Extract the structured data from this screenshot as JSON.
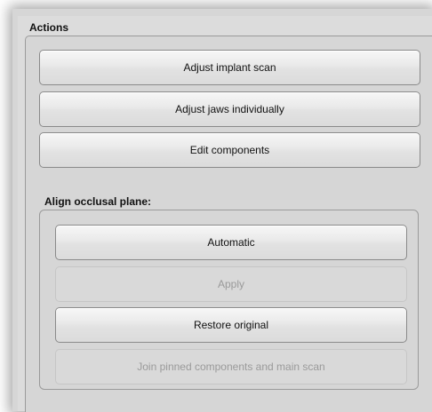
{
  "actions_panel": {
    "title": "Actions",
    "buttons": [
      {
        "label": "Adjust implant scan",
        "enabled": true
      },
      {
        "label": "Adjust jaws individually",
        "enabled": true
      },
      {
        "label": "Edit components",
        "enabled": true
      }
    ]
  },
  "align_panel": {
    "title": "Align occlusal plane:",
    "buttons": [
      {
        "label": "Automatic",
        "enabled": true
      },
      {
        "label": "Apply",
        "enabled": false
      },
      {
        "label": "Restore original",
        "enabled": true
      },
      {
        "label": "Join pinned components and main scan",
        "enabled": false
      }
    ]
  },
  "colors": {
    "panel_bg": "#d6d6d6",
    "button_border": "#8a8a8a",
    "disabled_text": "#9a9a9a"
  }
}
